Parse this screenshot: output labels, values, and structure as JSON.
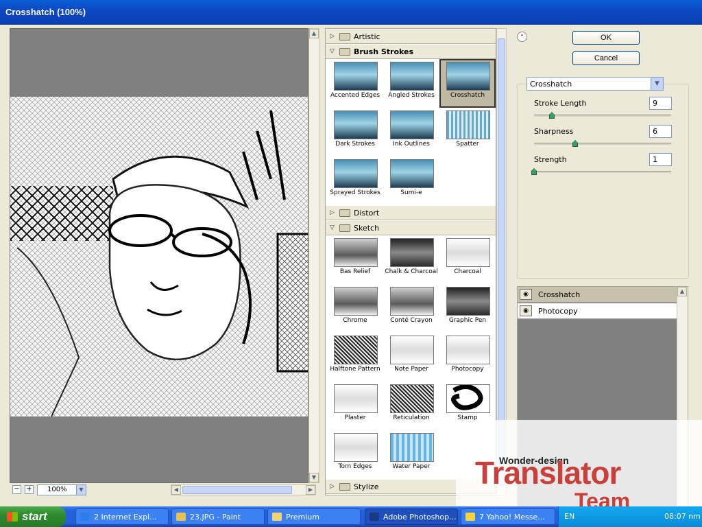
{
  "window": {
    "title": "Crosshatch (100%)"
  },
  "preview": {
    "zoom": "100%"
  },
  "gallery": {
    "categories": [
      {
        "name": "Artistic",
        "expanded": false
      },
      {
        "name": "Brush Strokes",
        "expanded": true,
        "filters": [
          "Accented Edges",
          "Angled Strokes",
          "Crosshatch",
          "Dark Strokes",
          "Ink Outlines",
          "Spatter",
          "Sprayed Strokes",
          "Sumi-e"
        ]
      },
      {
        "name": "Distort",
        "expanded": false
      },
      {
        "name": "Sketch",
        "expanded": true,
        "filters": [
          "Bas Relief",
          "Chalk & Charcoal",
          "Charcoal",
          "Chrome",
          "Conté Crayon",
          "Graphic Pen",
          "Halftone Pattern",
          "Note Paper",
          "Photocopy",
          "Plaster",
          "Reticulation",
          "Stamp",
          "Torn Edges",
          "Water Paper"
        ]
      },
      {
        "name": "Stylize",
        "expanded": false
      }
    ],
    "selected_filter": "Crosshatch"
  },
  "buttons": {
    "ok": "OK",
    "cancel": "Cancel"
  },
  "settings": {
    "filter": "Crosshatch",
    "params": [
      {
        "label": "Stroke Length",
        "value": "9"
      },
      {
        "label": "Sharpness",
        "value": "6"
      },
      {
        "label": "Strength",
        "value": "1"
      }
    ]
  },
  "layers": [
    {
      "name": "Crosshatch",
      "active": true
    },
    {
      "name": "Photocopy",
      "active": false
    }
  ],
  "watermark": {
    "top": "Wonder-design",
    "main": "Translator",
    "team": "Team"
  },
  "taskbar": {
    "start": "start",
    "tasks": [
      {
        "label": "2 Internet Expl...",
        "icon_color": "#2f7de8"
      },
      {
        "label": "23.JPG - Paint",
        "icon_color": "#e8c14d"
      },
      {
        "label": "Premium",
        "icon_color": "#f2d36b"
      },
      {
        "label": "Adobe Photoshop...",
        "icon_color": "#1b3a80"
      },
      {
        "label": "7 Yahoo! Messe...",
        "icon_color": "#f5d43a"
      }
    ],
    "language": "EN",
    "clock": "08:07 nm"
  }
}
